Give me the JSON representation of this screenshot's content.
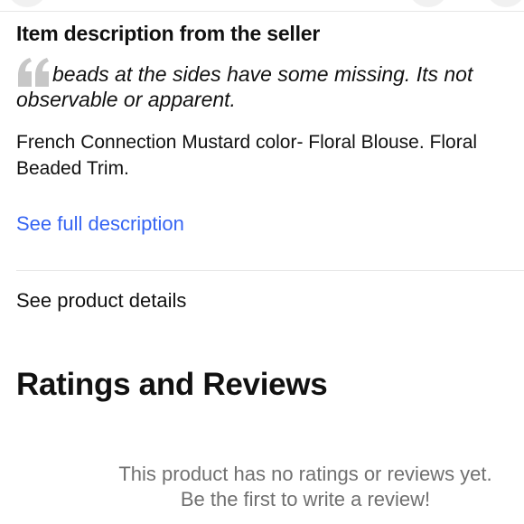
{
  "description": {
    "heading": "Item description from the seller",
    "quote": "beads at the sides have some missing. Its not observable or apparent.",
    "body": "French Connection Mustard color- Floral Blouse. Floral Beaded Trim.",
    "see_full_label": "See full description"
  },
  "product_details": {
    "label": "See product details"
  },
  "ratings": {
    "heading": "Ratings and Reviews",
    "empty_line1": "This product has no ratings or reviews yet.",
    "empty_line2": "Be the first to write a review!"
  },
  "icons": {
    "quote": "quote-mark-icon"
  },
  "colors": {
    "link": "#3665f3",
    "muted_text": "#707070",
    "quote_mark": "#c7c7c7",
    "divider": "#e6e6e6"
  }
}
